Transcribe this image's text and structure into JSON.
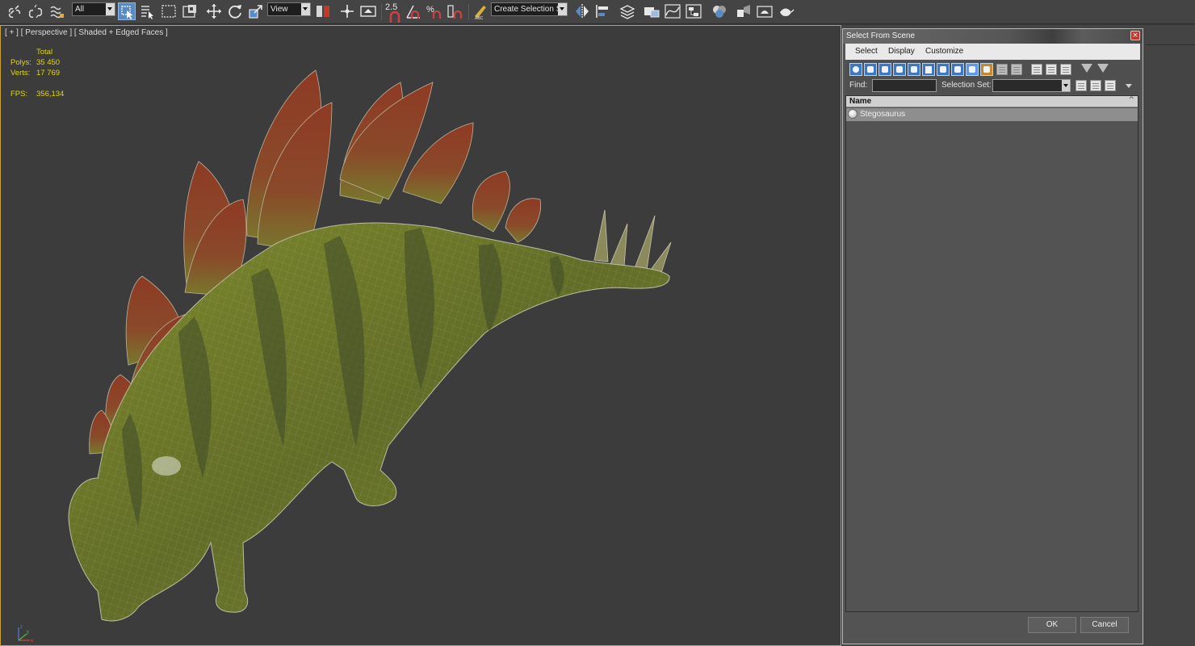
{
  "toolbar": {
    "selection_filter": "All",
    "reference_coord": "View",
    "snap_label": "2.5",
    "named_selection_placeholder": "Create Selection Se",
    "icons": [
      "link-icon",
      "unlink-icon",
      "bind-spacewarp-icon",
      "select-object-icon",
      "select-by-name-icon",
      "rect-region-icon",
      "window-crossing-icon",
      "move-icon",
      "rotate-icon",
      "scale-icon",
      "pivot-icon",
      "select-manipulate-icon",
      "keyboard-shortcut-icon",
      "snaps-toggle-icon",
      "angle-snap-icon",
      "percent-snap-icon",
      "spinner-snap-icon",
      "edit-named-selection-icon",
      "mirror-icon",
      "align-icon",
      "layer-manager-icon",
      "scene-explorer-icon",
      "curve-editor-icon",
      "schematic-view-icon",
      "material-editor-icon",
      "render-setup-icon",
      "rendered-frame-icon",
      "render-icon"
    ]
  },
  "viewport": {
    "label": "[ + ] [ Perspective ] [ Shaded + Edged Faces ]",
    "stats": {
      "header": "Total",
      "polys_label": "Polys:",
      "polys_value": "35 450",
      "verts_label": "Verts:",
      "verts_value": "17 769",
      "fps_label": "FPS:",
      "fps_value": "356,134"
    },
    "model": "stegosaurus-model",
    "axis_labels": [
      "x",
      "y",
      "z"
    ]
  },
  "dialog": {
    "title": "Select From Scene",
    "close": "×",
    "menu": [
      "Select",
      "Display",
      "Customize"
    ],
    "find_label": "Find:",
    "find_value": "",
    "selection_set_label": "Selection Set:",
    "selection_set_value": "",
    "column_name": "Name",
    "sort_indicator": "^",
    "objects": [
      {
        "name": "Stegosaurus",
        "icon": "geometry-sphere-icon"
      }
    ],
    "ok_label": "OK",
    "cancel_label": "Cancel"
  },
  "colors": {
    "stats": "#e1d60d",
    "viewport_border": "#c9a227",
    "active_button": "#5a8ac2",
    "filter_icon": "#3d78c3"
  }
}
